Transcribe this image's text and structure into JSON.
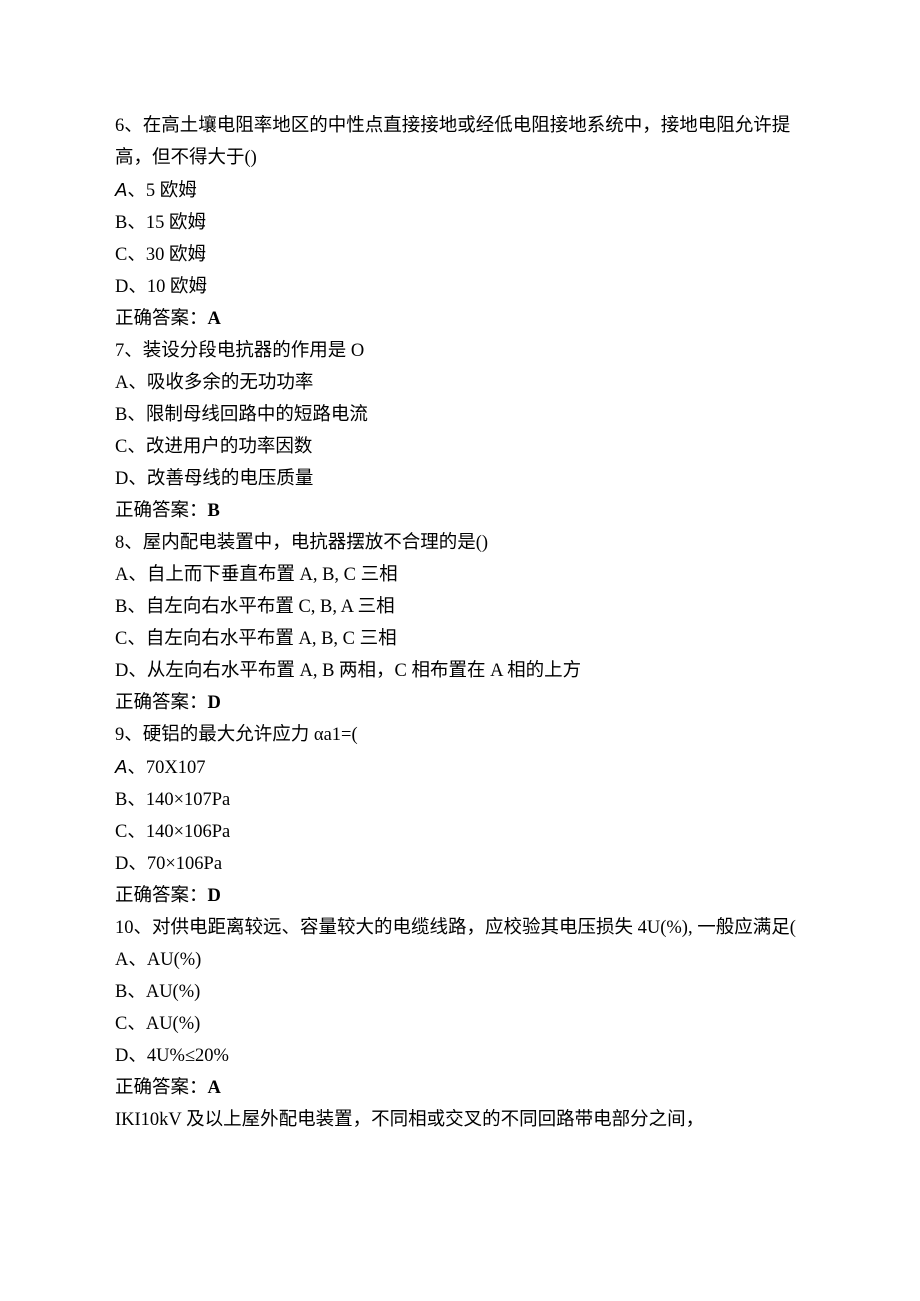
{
  "q6": {
    "stem": "6、在高土壤电阻率地区的中性点直接接地或经低电阻接地系统中，接地电阻允许提高，但不得大于()",
    "A_prefix": "A",
    "A_text": "、5 欧姆",
    "B": "B、15 欧姆",
    "C": "C、30 欧姆",
    "D": "D、10 欧姆",
    "ans_label": "正确答案：",
    "ans_value": "A"
  },
  "q7": {
    "stem": "7、装设分段电抗器的作用是 O",
    "A": "A、吸收多余的无功功率",
    "B": "B、限制母线回路中的短路电流",
    "C": "C、改进用户的功率因数",
    "D": "D、改善母线的电压质量",
    "ans_label": "正确答案：",
    "ans_value": "B"
  },
  "q8": {
    "stem": "8、屋内配电装置中，电抗器摆放不合理的是()",
    "A": "A、自上而下垂直布置 A, B, C 三相",
    "B": "B、自左向右水平布置 C, B, A 三相",
    "C": "C、自左向右水平布置 A, B, C 三相",
    "D": "D、从左向右水平布置 A, B 两相，C 相布置在 A 相的上方",
    "ans_label": "正确答案：",
    "ans_value": "D"
  },
  "q9": {
    "stem": "9、硬铝的最大允许应力 αa1=(",
    "A_prefix": "A",
    "A_text": "、70X107",
    "B": "B、140×107Pa",
    "C": "C、140×106Pa",
    "D": "D、70×106Pa",
    "ans_label": "正确答案：",
    "ans_value": "D"
  },
  "q10": {
    "stem": "10、对供电距离较远、容量较大的电缆线路，应校验其电压损失 4U(%), 一般应满足(",
    "A": "A、AU(%)",
    "B": "B、AU(%)",
    "C": "C、AU(%)",
    "D": "D、4U%≤20%",
    "ans_label": "正确答案：",
    "ans_value": "A"
  },
  "tail": "IKI10kV 及以上屋外配电装置，不同相或交叉的不同回路带电部分之间，"
}
